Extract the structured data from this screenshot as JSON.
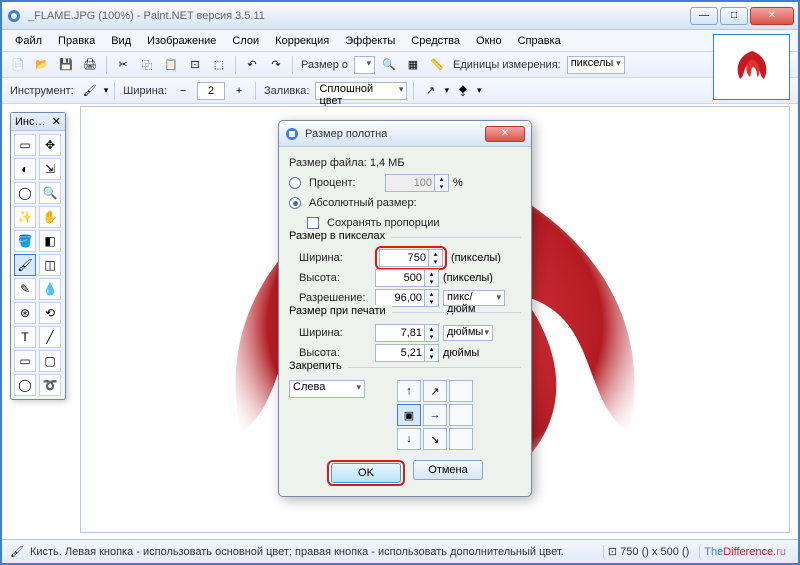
{
  "window": {
    "title": "_FLAME.JPG (100%) - Paint.NET версия 3.5.11"
  },
  "menu": [
    "Файл",
    "Правка",
    "Вид",
    "Изображение",
    "Слои",
    "Коррекция",
    "Эффекты",
    "Средства",
    "Окно",
    "Справка"
  ],
  "toolbar1": {
    "canvas_size_label": "Размер о",
    "units_label": "Единицы измерения:",
    "units_value": "пикселы"
  },
  "toolbar2": {
    "tool_label": "Инструмент:",
    "width_label": "Ширина:",
    "width_value": "2",
    "fill_label": "Заливка:",
    "fill_value": "Сплошной цвет"
  },
  "toolpal": {
    "title": "Инс…"
  },
  "dialog": {
    "title": "Размер полотна",
    "filesize_label": "Размер файла: 1,4 МБ",
    "percent_label": "Процент:",
    "percent_value": "100",
    "percent_suffix": "%",
    "absolute_label": "Абсолютный размер:",
    "keep_aspect": "Сохранять пропорции",
    "px_group": "Размер в пикселах",
    "width_label": "Ширина:",
    "width_value": "750",
    "px_suffix": "(пикселы)",
    "height_label": "Высота:",
    "height_value": "500",
    "res_label": "Разрешение:",
    "res_value": "96,00",
    "res_unit": "пикс/дюйм",
    "print_group": "Размер при печати",
    "pwidth_value": "7,81",
    "pheight_value": "5,21",
    "print_unit": "дюймы",
    "anchor_label": "Закрепить",
    "anchor_value": "Слева",
    "ok": "OK",
    "cancel": "Отмена"
  },
  "status": {
    "text": "Кисть. Левая кнопка - использовать основной цвет; правая кнопка - использовать дополнительный цвет.",
    "dims": "750 () x 500 ()",
    "brand1": "The",
    "brand2": "Difference",
    "brand3": ".ru"
  }
}
